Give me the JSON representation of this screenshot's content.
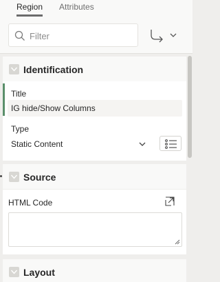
{
  "tabs": [
    {
      "label": "Region",
      "active": true
    },
    {
      "label": "Attributes",
      "active": false
    }
  ],
  "toolbar": {
    "filter_placeholder": "Filter",
    "filter_value": "",
    "goto_icon": "go-to-group-icon",
    "dropdown_icon": "chevron-down-icon"
  },
  "sections": {
    "identification": {
      "title": "Identification",
      "fields": {
        "title_label": "Title",
        "title_value": "IG hide/Show Columns",
        "type_label": "Type",
        "type_value": "Static Content"
      }
    },
    "source": {
      "title": "Source",
      "fields": {
        "html_code_label": "HTML Code",
        "html_code_value": ""
      }
    },
    "layout": {
      "title": "Layout"
    }
  },
  "colors": {
    "panel_bg": "#efeeec",
    "header_bg": "#f9f9f8",
    "body_bg": "#ffffff",
    "accent_green": "#5a8f6a",
    "text": "#262626"
  }
}
